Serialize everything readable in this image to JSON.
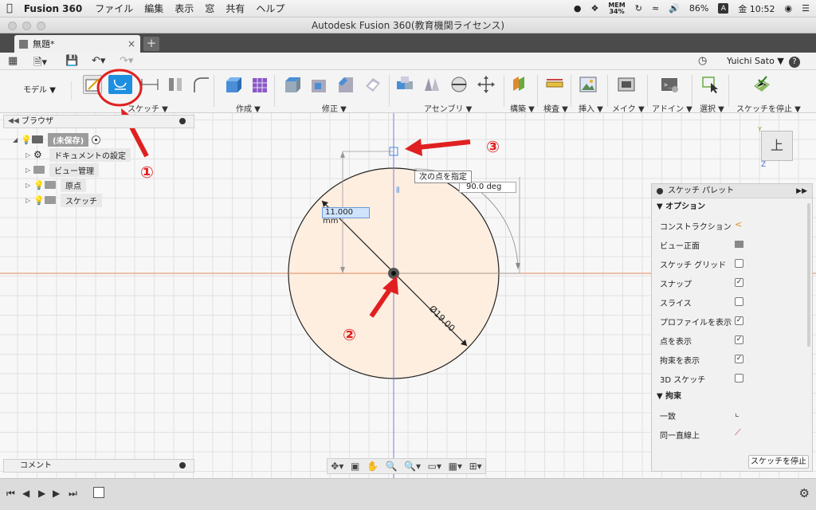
{
  "menubar": {
    "apple": "",
    "app_name": "Fusion 360",
    "menus": [
      "ファイル",
      "編集",
      "表示",
      "窓",
      "共有",
      "ヘルプ"
    ],
    "mem_label": "MEM",
    "mem_value": "34%",
    "battery": "86%",
    "input_mode": "A",
    "clock": "金 10:52"
  },
  "window": {
    "title": "Autodesk Fusion 360(教育機関ライセンス)"
  },
  "tabs": {
    "doc_tab": "無題*",
    "close": "×",
    "new_tab": "+"
  },
  "qab": {
    "user": "Yuichi Sato ▼",
    "help": "?"
  },
  "toolbar": {
    "workspace": "モデル ▼",
    "groups": [
      "スケッチ ▼",
      "作成 ▼",
      "修正 ▼",
      "アセンブリ ▼",
      "構築 ▼",
      "検査 ▼",
      "挿入 ▼",
      "メイク ▼",
      "アドイン ▼",
      "選択 ▼",
      "スケッチを停止 ▼"
    ]
  },
  "browser": {
    "title": "ブラウザ",
    "root": "(未保存)",
    "items": [
      "ドキュメントの設定",
      "ビュー管理",
      "原点",
      "スケッチ"
    ]
  },
  "canvas": {
    "tooltip": "次の点を指定",
    "radius_input": "11.000 mm",
    "angle_input": "90.0 deg",
    "diameter_dim": "Ø19.00"
  },
  "annotations": {
    "one": "①",
    "two": "②",
    "three": "③"
  },
  "viewcube": {
    "face": "上",
    "axis_y": "Y",
    "axis_z": "Z"
  },
  "palette": {
    "title": "スケッチ パレット",
    "options_header": "▼ オプション",
    "options": [
      {
        "label": "コンストラクション",
        "type": "icon"
      },
      {
        "label": "ビュー正面",
        "type": "icon"
      },
      {
        "label": "スケッチ グリッド",
        "checked": false
      },
      {
        "label": "スナップ",
        "checked": true
      },
      {
        "label": "スライス",
        "checked": false
      },
      {
        "label": "プロファイルを表示",
        "checked": true
      },
      {
        "label": "点を表示",
        "checked": true
      },
      {
        "label": "拘束を表示",
        "checked": true
      },
      {
        "label": "3D スケッチ",
        "checked": false
      }
    ],
    "constraints_header": "▼ 拘束",
    "constraints": [
      "一致",
      "同一直線上"
    ],
    "stop_button": "スケッチを停止"
  },
  "comment": {
    "title": "コメント"
  },
  "colors": {
    "accent": "#1e8fe0",
    "annotation": "#e02020",
    "circle_fill": "#fdeee0",
    "x_axis": "#e08a5a",
    "y_axis": "#7a7ad8"
  }
}
